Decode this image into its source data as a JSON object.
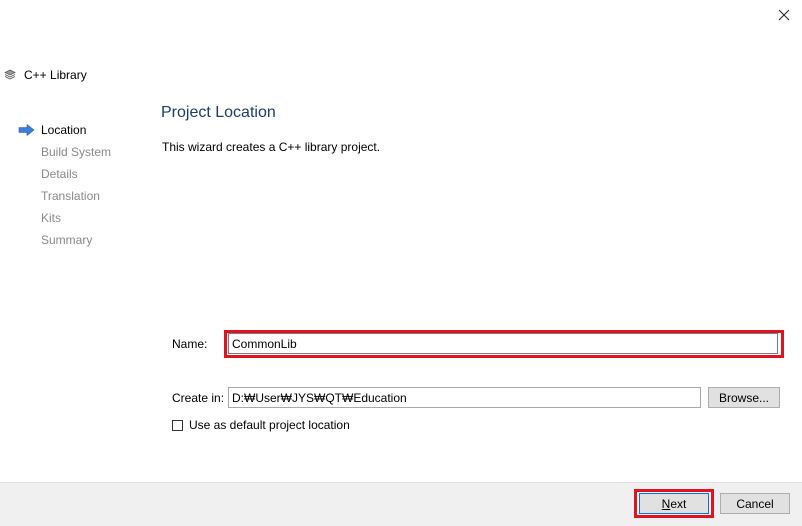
{
  "window": {
    "close_icon": "close-icon"
  },
  "wizard": {
    "title": "C++ Library",
    "title_icon": "stack-icon"
  },
  "steps": [
    {
      "label": "Location",
      "active": true
    },
    {
      "label": "Build System",
      "active": false
    },
    {
      "label": "Details",
      "active": false
    },
    {
      "label": "Translation",
      "active": false
    },
    {
      "label": "Kits",
      "active": false
    },
    {
      "label": "Summary",
      "active": false
    }
  ],
  "page": {
    "title": "Project Location",
    "description": "This wizard creates a C++ library project."
  },
  "form": {
    "name_label": "Name:",
    "name_value": "CommonLib",
    "create_in_label": "Create in:",
    "create_in_value": "D:₩User₩JYS₩QT₩Education",
    "browse_label": "Browse...",
    "default_location_label": "Use as default project location",
    "default_location_checked": false
  },
  "footer": {
    "next_mnemonic": "N",
    "next_rest": "ext",
    "cancel_label": "Cancel"
  },
  "colors": {
    "highlight": "#e0141e",
    "active_arrow": "#3c7fd9",
    "title_blue": "#1f3b6e"
  }
}
